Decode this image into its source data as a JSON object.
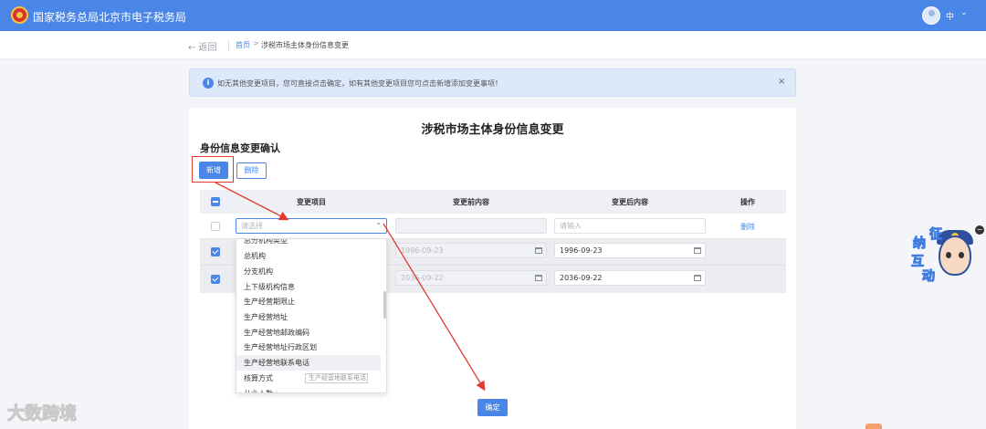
{
  "header": {
    "site_title": "国家税务总局北京市电子税务局",
    "user_name": "中",
    "user_chevron": "⌄"
  },
  "breadcrumb": {
    "back_label": "← 返回",
    "home_label": "首页",
    "separator": ">",
    "current_label": "涉税市场主体身份信息变更"
  },
  "notice": {
    "text": "如无其他变更项目，您可直接点击确定，如有其他变更项目您可点击新增添加变更事项！",
    "close": "×"
  },
  "page": {
    "main_title": "涉税市场主体身份信息变更",
    "section_title": "身份信息变更确认",
    "add_button": "新增",
    "delete_button": "删除",
    "confirm_button": "确定"
  },
  "table": {
    "columns": [
      "变更项目",
      "变更前内容",
      "变更后内容",
      "操作"
    ],
    "rows": [
      {
        "checked": false,
        "item_placeholder": "请选择",
        "before": "",
        "after_placeholder": "请输入",
        "action": "删除"
      },
      {
        "checked": true,
        "before": "1996-09-23",
        "after": "1996-09-23"
      },
      {
        "checked": true,
        "before": "2036-09-22",
        "after": "2036-09-22"
      }
    ]
  },
  "dropdown": {
    "options": [
      "总分机构类型",
      "总机构",
      "分支机构",
      "上下级机构信息",
      "生产经营期限止",
      "生产经营地址",
      "生产经营地邮政编码",
      "生产经营地址行政区划",
      "生产经营地联系电话",
      "核算方式",
      "从业人数"
    ],
    "hovered_option": "生产经营地联系电话",
    "tooltip": "生产经营地联系电话"
  },
  "widget": {
    "chars": [
      "征",
      "纳",
      "互",
      "动"
    ],
    "close": "−"
  },
  "watermark": {
    "text": "大数跨境"
  },
  "colors": {
    "primary": "#4a86e8",
    "highlight_red": "#e03a2f",
    "notice_bg": "#dde8fb"
  }
}
